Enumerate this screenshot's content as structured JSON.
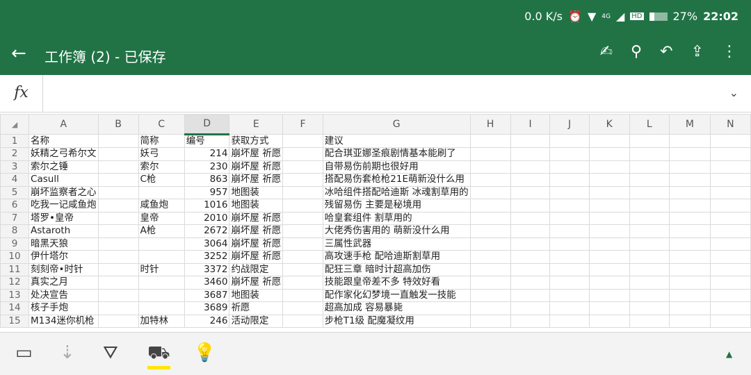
{
  "status": {
    "net": "0.0 K/s",
    "net_type": "4G",
    "hd": "HD",
    "battery": "27%",
    "time": "22:02"
  },
  "appbar": {
    "title": "工作簿 (2) - 已保存"
  },
  "formula": {
    "label": "fx",
    "value": ""
  },
  "columns": [
    "A",
    "B",
    "C",
    "D",
    "E",
    "F",
    "G",
    "H",
    "I",
    "J",
    "K",
    "L",
    "M",
    "N"
  ],
  "rows": [
    [
      "1",
      "名称",
      "简称",
      "编号",
      "获取方式",
      "建议"
    ],
    [
      "2",
      "妖精之弓希尔文",
      "妖弓",
      "214",
      "崩坏屋 祈愿",
      "配合琪亚娜圣痕剧情基本能刷了"
    ],
    [
      "3",
      "索尔之锤",
      "索尔",
      "230",
      "崩坏屋 祈愿",
      "自带易伤前期也很好用"
    ],
    [
      "4",
      "Casull",
      "C枪",
      "863",
      "崩坏屋 祈愿",
      "搭配易伤套枪枪21E萌新没什么用"
    ],
    [
      "5",
      "崩坏监察者之心",
      "",
      "957",
      "地图装",
      "冰哈组件搭配哈迪斯 冰魂割草用的"
    ],
    [
      "6",
      "吃我一记咸鱼炮",
      "咸鱼炮",
      "1016",
      "地图装",
      "残留易伤 主要是秘境用"
    ],
    [
      "7",
      "塔罗•皇帝",
      "皇帝",
      "2010",
      "崩坏屋 祈愿",
      "哈皇套组件 割草用的"
    ],
    [
      "8",
      "Astaroth",
      "A枪",
      "2672",
      "崩坏屋 祈愿",
      "大佬秀伤害用的 萌新没什么用"
    ],
    [
      "9",
      "暗黑天狼",
      "",
      "3064",
      "崩坏屋 祈愿",
      "三属性武器"
    ],
    [
      "10",
      "伊什塔尔",
      "",
      "3252",
      "崩坏屋 祈愿",
      "高攻速手枪 配哈迪斯割草用"
    ],
    [
      "11",
      "刻刻帝•时针",
      "时针",
      "3372",
      "约战限定",
      "配狂三章 暗时计超高加伤"
    ],
    [
      "12",
      "真实之月",
      "",
      "3460",
      "崩坏屋 祈愿",
      "技能跟皇帝差不多 特效好看"
    ],
    [
      "13",
      "处决宣告",
      "",
      "3687",
      "地图装",
      "配作家化幻梦境一直触发一技能"
    ],
    [
      "14",
      "核子手炮",
      "",
      "3689",
      "祈愿",
      "超高加成 容易暴毙"
    ],
    [
      "15",
      "M134迷你机枪",
      "加特林",
      "246",
      "活动限定",
      "步枪T1级 配魔凝纹用"
    ]
  ]
}
